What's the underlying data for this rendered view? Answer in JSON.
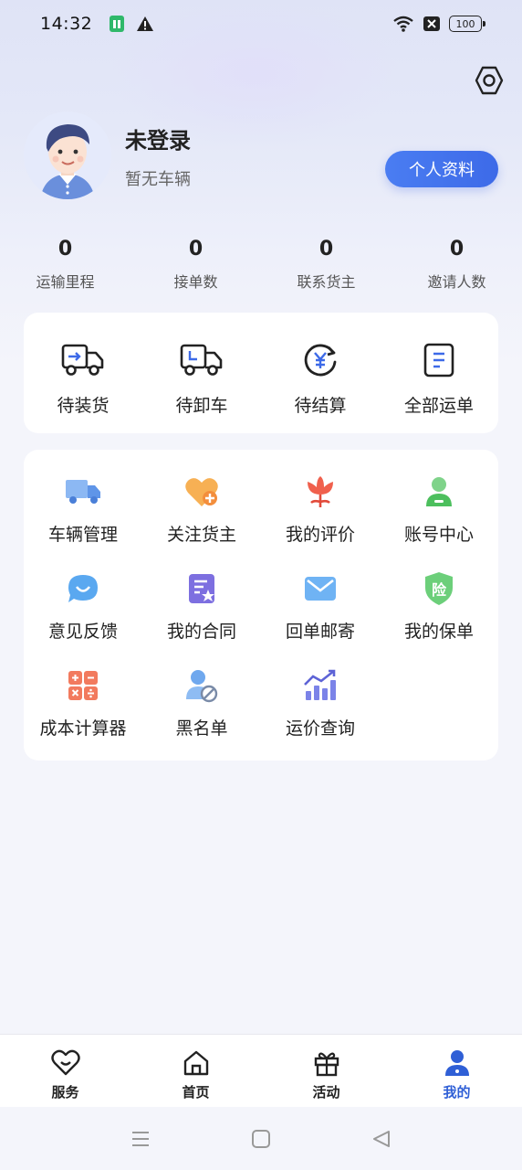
{
  "status_bar": {
    "time": "14:32",
    "battery": "100"
  },
  "colors": {
    "accent": "#3d6ae8",
    "active_tab": "#2f5fd6",
    "card_bg": "#ffffff",
    "page_bg": "#f4f5fb"
  },
  "header": {
    "settings_icon": "hexagon-gear-icon",
    "avatar_icon": "cartoon-avatar",
    "user_name": "未登录",
    "vehicle_status": "暂无车辆",
    "profile_button": "个人资料"
  },
  "stats": [
    {
      "value": "0",
      "label": "运输里程"
    },
    {
      "value": "0",
      "label": "接单数"
    },
    {
      "value": "0",
      "label": "联系货主"
    },
    {
      "value": "0",
      "label": "邀请人数"
    }
  ],
  "orders": [
    {
      "label": "待装货",
      "icon": "truck-loading-icon"
    },
    {
      "label": "待卸车",
      "icon": "truck-unloading-icon"
    },
    {
      "label": "待结算",
      "icon": "yuan-refresh-icon"
    },
    {
      "label": "全部运单",
      "icon": "document-list-icon"
    }
  ],
  "services": [
    {
      "label": "车辆管理",
      "icon": "truck-icon"
    },
    {
      "label": "关注货主",
      "icon": "heart-plus-icon"
    },
    {
      "label": "我的评价",
      "icon": "flower-icon"
    },
    {
      "label": "账号中心",
      "icon": "user-icon"
    },
    {
      "label": "意见反馈",
      "icon": "chat-smile-icon"
    },
    {
      "label": "我的合同",
      "icon": "contract-star-icon"
    },
    {
      "label": "回单邮寄",
      "icon": "mail-icon"
    },
    {
      "label": "我的保单",
      "icon": "insurance-shield-icon",
      "badge": "险"
    },
    {
      "label": "成本计算器",
      "icon": "calculator-icon"
    },
    {
      "label": "黑名单",
      "icon": "user-blocked-icon"
    },
    {
      "label": "运价查询",
      "icon": "chart-trend-icon"
    }
  ],
  "tabbar": [
    {
      "label": "服务",
      "icon": "heart-icon",
      "active": false
    },
    {
      "label": "首页",
      "icon": "home-icon",
      "active": false
    },
    {
      "label": "活动",
      "icon": "gift-icon",
      "active": false
    },
    {
      "label": "我的",
      "icon": "person-icon",
      "active": true
    }
  ]
}
